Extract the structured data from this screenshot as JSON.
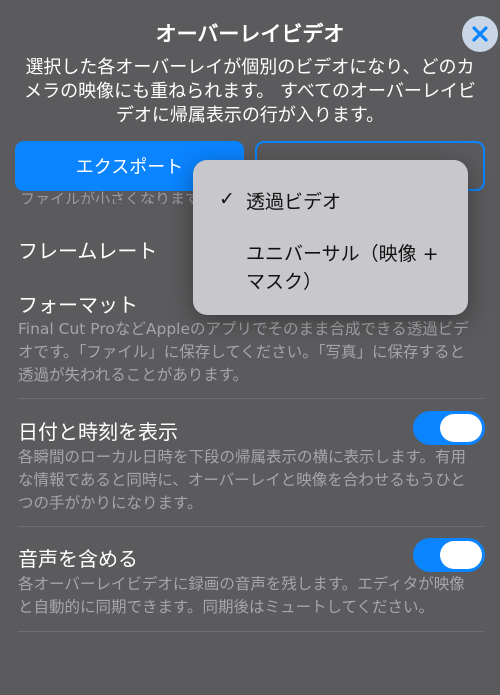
{
  "header": {
    "title": "オーバーレイビデオ",
    "subtitle": "選択した各オーバーレイが個別のビデオになり、どのカメラの映像にも重ねられます。 すべてのオーバーレイビデオに帰属表示の行が入ります。"
  },
  "actions": {
    "export_label": "エクスポート"
  },
  "partially_hidden_text": "ファイルが小さくなります。",
  "settings": {
    "frame_rate": {
      "label": "フレームレート"
    },
    "format": {
      "label": "フォーマット",
      "description": "Final Cut ProなどAppleのアプリでそのまま合成できる透過ビデオです。「ファイル」に保存してください。「写真」に保存すると透過が失われることがあります。"
    },
    "datetime": {
      "label": "日付と時刻を表示",
      "description": "各瞬間のローカル日時を下段の帰属表示の横に表示します。有用な情報であると同時に、オーバーレイと映像を合わせるもうひとつの手がかりになります。",
      "enabled": true
    },
    "audio": {
      "label": "音声を含める",
      "description": "各オーバーレイビデオに録画の音声を残します。エディタが映像と自動的に同期できます。同期後はミュートしてください。",
      "enabled": true
    }
  },
  "format_menu": {
    "check_mark": "✓",
    "items": [
      {
        "label": "透過ビデオ",
        "selected": true
      },
      {
        "label": "ユニバーサル（映像 + マスク）",
        "selected": false
      }
    ]
  },
  "colors": {
    "accent": "#0a84ff",
    "sheet_bg": "#5b5b5d",
    "menu_bg": "#c8c8cc"
  }
}
